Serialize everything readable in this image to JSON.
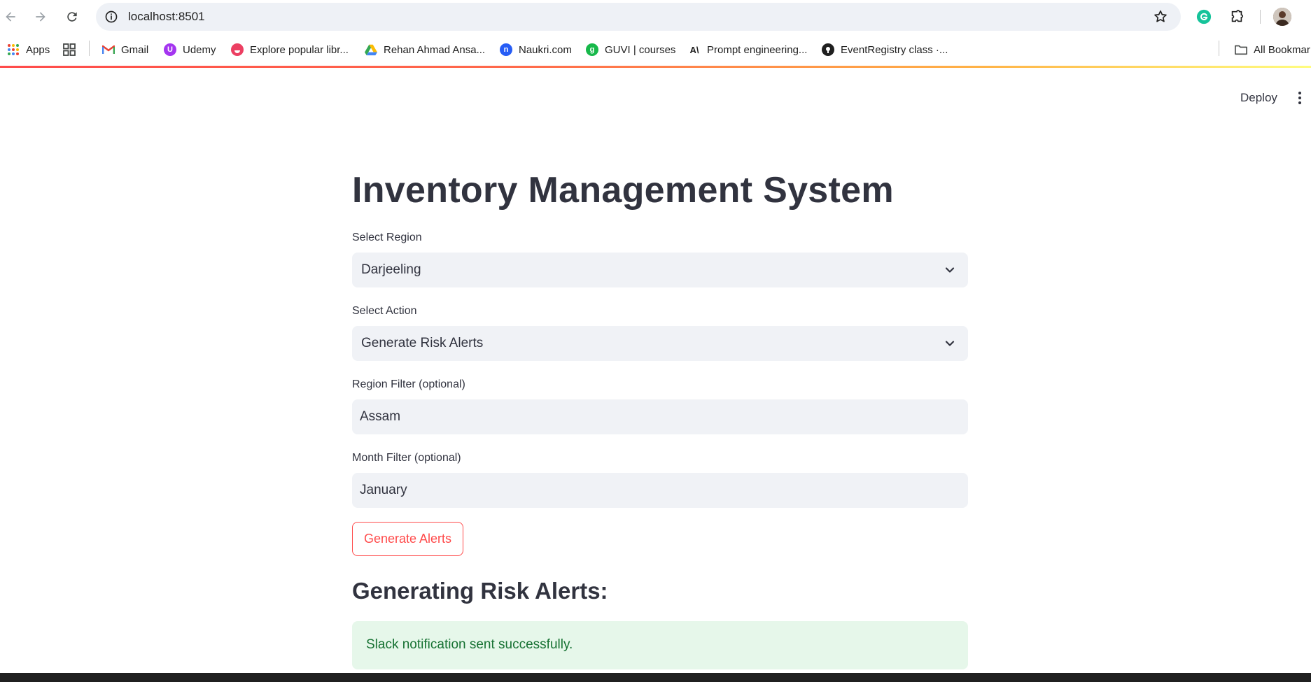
{
  "browser": {
    "url": "localhost:8501",
    "bookmarks": [
      {
        "label": "Apps",
        "icon": "apps-grid-icon"
      },
      {
        "label": "",
        "icon": "tab-groups-icon"
      },
      {
        "label": "Gmail",
        "icon": "gmail-icon"
      },
      {
        "label": "Udemy",
        "icon": "udemy-icon"
      },
      {
        "label": "Explore popular libr...",
        "icon": "explore-icon"
      },
      {
        "label": "Rehan Ahmad Ansa...",
        "icon": "google-drive-icon"
      },
      {
        "label": "Naukri.com",
        "icon": "naukri-icon"
      },
      {
        "label": "GUVI | courses",
        "icon": "guvi-icon"
      },
      {
        "label": "Prompt engineering...",
        "icon": "anthropic-icon"
      },
      {
        "label": "EventRegistry class ·...",
        "icon": "github-icon"
      }
    ],
    "all_bookmarks_label": "All Bookmar"
  },
  "app": {
    "deploy_label": "Deploy",
    "title": "Inventory Management System",
    "region": {
      "label": "Select Region",
      "value": "Darjeeling"
    },
    "action": {
      "label": "Select Action",
      "value": "Generate Risk Alerts"
    },
    "region_filter": {
      "label": "Region Filter (optional)",
      "value": "Assam"
    },
    "month_filter": {
      "label": "Month Filter (optional)",
      "value": "January"
    },
    "button_label": "Generate Alerts",
    "subheader": "Generating Risk Alerts:",
    "success_message": "Slack notification sent successfully."
  },
  "colors": {
    "accent": "#ff4b4b",
    "input_bg": "#f0f2f6",
    "success_bg": "#e6f7ea",
    "success_text": "#177233",
    "text": "#31333f"
  }
}
